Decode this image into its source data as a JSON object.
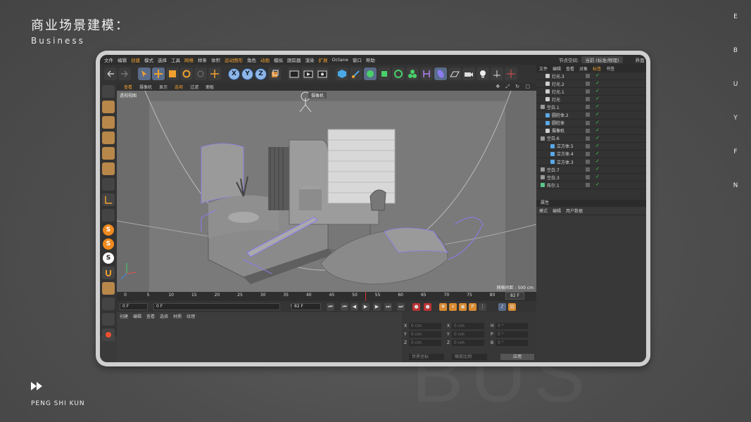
{
  "slide": {
    "title": "商业场景建模：",
    "subtitle": "Business",
    "side_letters": [
      "E",
      "B",
      "U",
      "Y",
      "F",
      "N"
    ],
    "author": "PENG SHI KUN",
    "background_word": "BUS"
  },
  "menubar": {
    "items": [
      "文件",
      "编辑",
      "创建",
      "模式",
      "选择",
      "工具",
      "网格",
      "样条",
      "体积",
      "运动图形",
      "角色",
      "动画",
      "模拟",
      "跟踪器",
      "渲染",
      "扩展",
      "Octane",
      "窗口",
      "帮助"
    ],
    "highlighted": [
      "创建",
      "网格",
      "运动图形",
      "动画",
      "扩展"
    ],
    "node_space_label": "节点空间:",
    "node_space_value": "当前 (标准/物理)",
    "layout_label": "界面"
  },
  "toolbar": {
    "icons": [
      "undo-icon",
      "redo-icon",
      "select-icon",
      "move-icon",
      "scale-icon",
      "rotate-icon",
      "recent-icon",
      "move-tool-icon",
      "x-axis-icon",
      "y-axis-icon",
      "z-axis-icon",
      "coordinate-icon",
      "render-region-icon",
      "render-view-icon",
      "render-settings-icon",
      "cube-icon",
      "pen-icon",
      "subdivision-icon",
      "extrude-icon",
      "cloner-icon",
      "mograph-icon",
      "deformer-icon",
      "field-icon",
      "floor-icon",
      "camera-icon",
      "light-icon",
      "scene-icon",
      "axis-icon"
    ],
    "xyz": [
      "X",
      "Y",
      "Z"
    ]
  },
  "left_tools": [
    "model-mode-icon",
    "cube-mode-icon",
    "texture-icon",
    "points-icon",
    "edges-icon",
    "polygons-icon",
    "uv-icon",
    "axis-mode-icon",
    "snap-icon",
    "workplane-icon",
    "solo-icon",
    "live-select-icon",
    "s1-icon",
    "s2-icon",
    "magnet-icon",
    "grid-icon",
    "brush-icon",
    "layer-icon",
    "paint-icon"
  ],
  "viewport": {
    "menu": [
      "查看",
      "摄像机",
      "显示",
      "选项",
      "过滤",
      "面板"
    ],
    "highlighted": [
      "查看",
      "选项"
    ],
    "view_name": "透视视图",
    "camera_name": "摄像机",
    "grid_spacing": "网格间距 : 500 cm"
  },
  "timeline": {
    "ticks": [
      "0",
      "5",
      "10",
      "15",
      "20",
      "25",
      "30",
      "35",
      "40",
      "45",
      "50",
      "55",
      "60",
      "65",
      "70",
      "75",
      "80"
    ],
    "end_frame": "82 F"
  },
  "playbar": {
    "start": "0 F",
    "current": "0 F",
    "min_end": "82 F",
    "max_end": "82 F"
  },
  "material_manager": {
    "menu": [
      "创建",
      "编辑",
      "查看",
      "选择",
      "材质",
      "纹理"
    ]
  },
  "coordinates": {
    "rows": [
      {
        "axis": "X",
        "pos": "0 cm",
        "size_axis": "X",
        "size": "0 cm",
        "rot_axis": "H",
        "rot": "0 °"
      },
      {
        "axis": "Y",
        "pos": "0 cm",
        "size_axis": "Y",
        "size": "0 cm",
        "rot_axis": "P",
        "rot": "0 °"
      },
      {
        "axis": "Z",
        "pos": "0 cm",
        "size_axis": "Z",
        "size": "0 cm",
        "rot_axis": "B",
        "rot": "0 °"
      }
    ],
    "world_mode": "世界坐标",
    "scale_mode": "缩放比例",
    "apply_label": "应用"
  },
  "object_manager": {
    "tabs": [
      "文件",
      "编辑",
      "查看",
      "对象",
      "标签",
      "书签"
    ],
    "highlighted": [
      "标签"
    ],
    "objects": [
      {
        "name": "灯光.3",
        "color": "#cfcfcf",
        "indent": 1
      },
      {
        "name": "灯光.2",
        "color": "#cfcfcf",
        "indent": 1
      },
      {
        "name": "灯光.1",
        "color": "#cfcfcf",
        "indent": 1
      },
      {
        "name": "灯光",
        "color": "#cfcfcf",
        "indent": 1
      },
      {
        "name": "空白.1",
        "color": "#9a9a9a",
        "indent": 0
      },
      {
        "name": "圆柱体.2",
        "color": "#5aa8e8",
        "indent": 1
      },
      {
        "name": "圆柱体",
        "color": "#5aa8e8",
        "indent": 1
      },
      {
        "name": "摄像机",
        "color": "#cfcfcf",
        "indent": 1
      },
      {
        "name": "空白.6",
        "color": "#9a9a9a",
        "indent": 0
      },
      {
        "name": "立方体.5",
        "color": "#5aa8e8",
        "indent": 2
      },
      {
        "name": "立方体.4",
        "color": "#5aa8e8",
        "indent": 2
      },
      {
        "name": "立方体.3",
        "color": "#5aa8e8",
        "indent": 2
      },
      {
        "name": "空白.7",
        "color": "#9a9a9a",
        "indent": 0
      },
      {
        "name": "空白.3",
        "color": "#9a9a9a",
        "indent": 0
      },
      {
        "name": "布尔.1",
        "color": "#5ac88a",
        "indent": 0
      }
    ]
  },
  "attributes": {
    "title": "属性",
    "menu": [
      "模式",
      "编辑",
      "用户数据"
    ]
  },
  "colors": {
    "accent": "#f0a030",
    "check": "#3fd24a",
    "selection": "#8a7cf0",
    "frame": "#cfcfcf"
  }
}
